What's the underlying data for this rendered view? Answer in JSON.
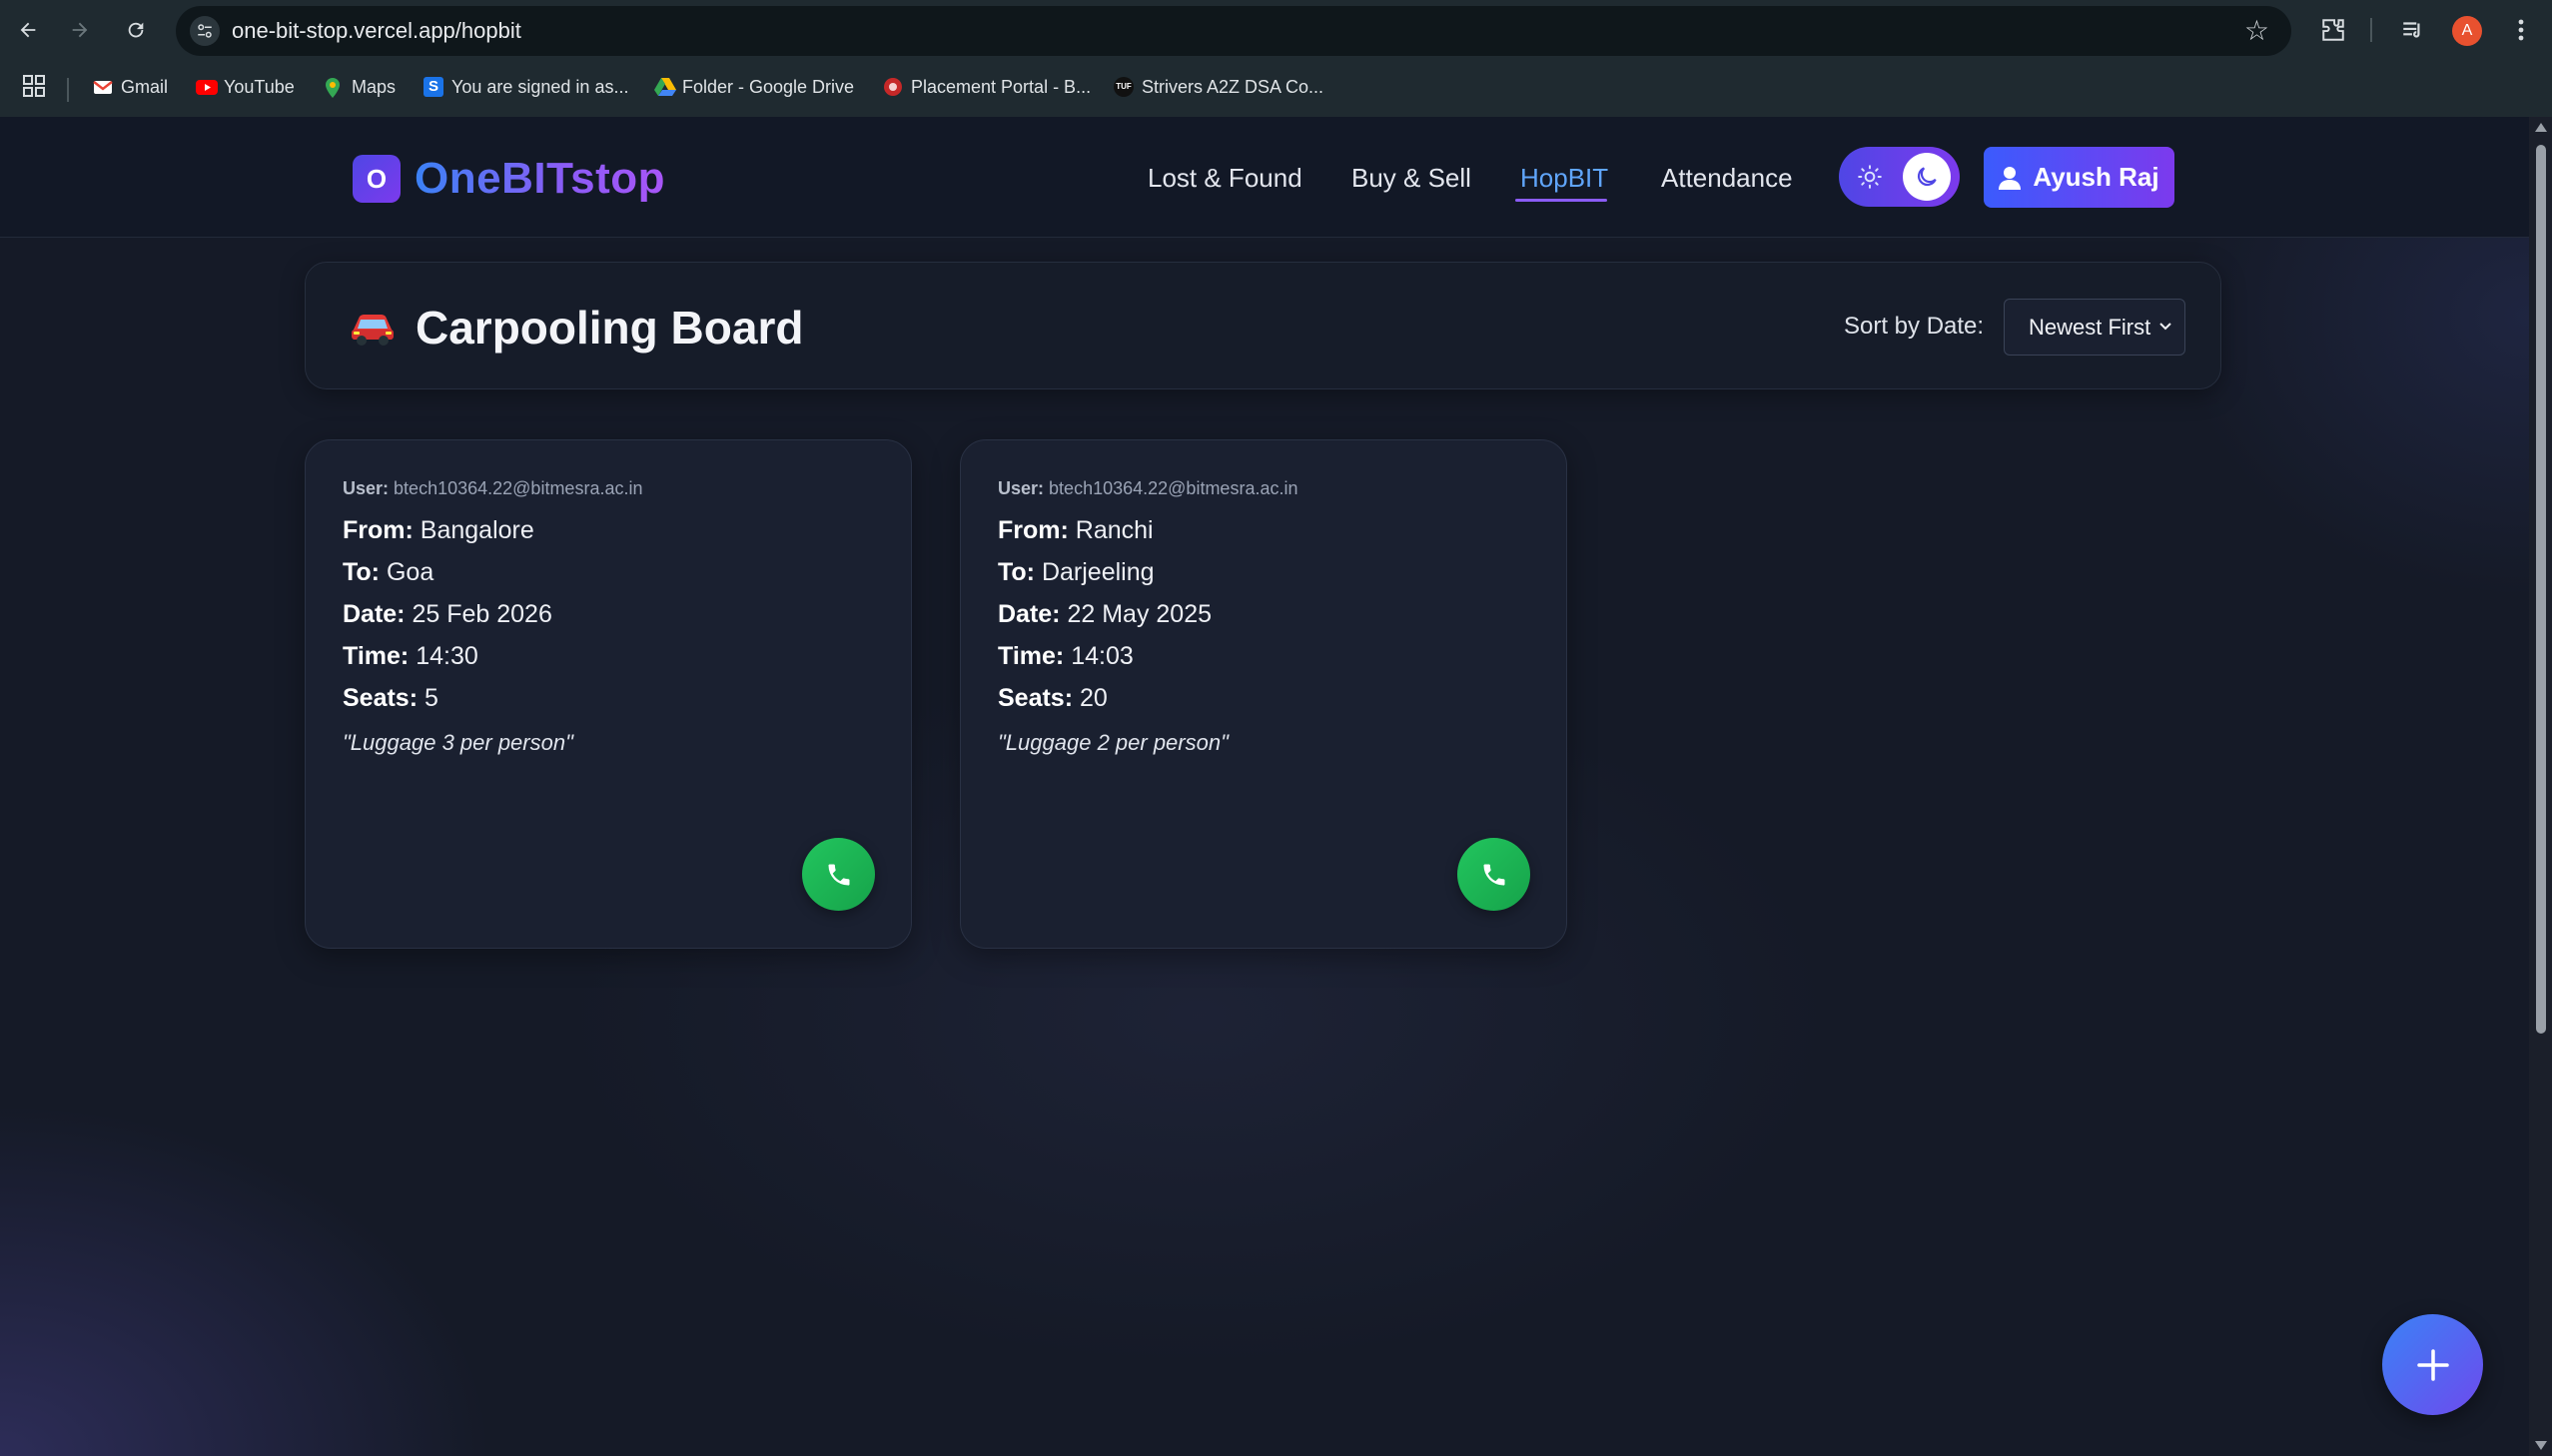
{
  "browser": {
    "url": "one-bit-stop.vercel.app/hopbit",
    "profile_initial": "A",
    "bookmarks": [
      {
        "label": "Gmail",
        "icon": "gmail-icon",
        "color": "#ea4335"
      },
      {
        "label": "YouTube",
        "icon": "youtube-icon",
        "color": "#ff0000"
      },
      {
        "label": "Maps",
        "icon": "maps-icon",
        "color": "#34a853"
      },
      {
        "label": "You are signed in as...",
        "icon": "s-icon",
        "color": "#1a73e8"
      },
      {
        "label": "Folder - Google Drive",
        "icon": "drive-icon",
        "color": "#fbbc04"
      },
      {
        "label": "Placement Portal - B...",
        "icon": "portal-icon",
        "color": "#c62828"
      },
      {
        "label": "Strivers A2Z DSA Co...",
        "icon": "tuf-icon",
        "color": "#111111"
      }
    ]
  },
  "nav": {
    "brand": "OneBITstop",
    "brand_initial": "O",
    "links": [
      "Lost & Found",
      "Buy & Sell",
      "HopBIT",
      "Attendance"
    ],
    "active_link": "HopBIT",
    "user_name": "Ayush Raj"
  },
  "board": {
    "title": "Carpooling Board",
    "sort_label": "Sort by Date:",
    "sort_value": "Newest First"
  },
  "labels": {
    "user": "User:",
    "from": "From:",
    "to": "To:",
    "date": "Date:",
    "time": "Time:",
    "seats": "Seats:"
  },
  "rides": [
    {
      "user": "btech10364.22@bitmesra.ac.in",
      "from": "Bangalore",
      "to": "Goa",
      "date": "25 Feb 2026",
      "time": "14:30",
      "seats": "5",
      "note": "\"Luggage 3 per person\""
    },
    {
      "user": "btech10364.22@bitmesra.ac.in",
      "from": "Ranchi",
      "to": "Darjeeling",
      "date": "22 May 2025",
      "time": "14:03",
      "seats": "20",
      "note": "\"Luggage 2 per person\""
    }
  ],
  "colors": {
    "accent_blue": "#3b82f6",
    "accent_purple": "#7c3aed",
    "call_green": "#22c55e",
    "page_bg": "#151a27"
  }
}
